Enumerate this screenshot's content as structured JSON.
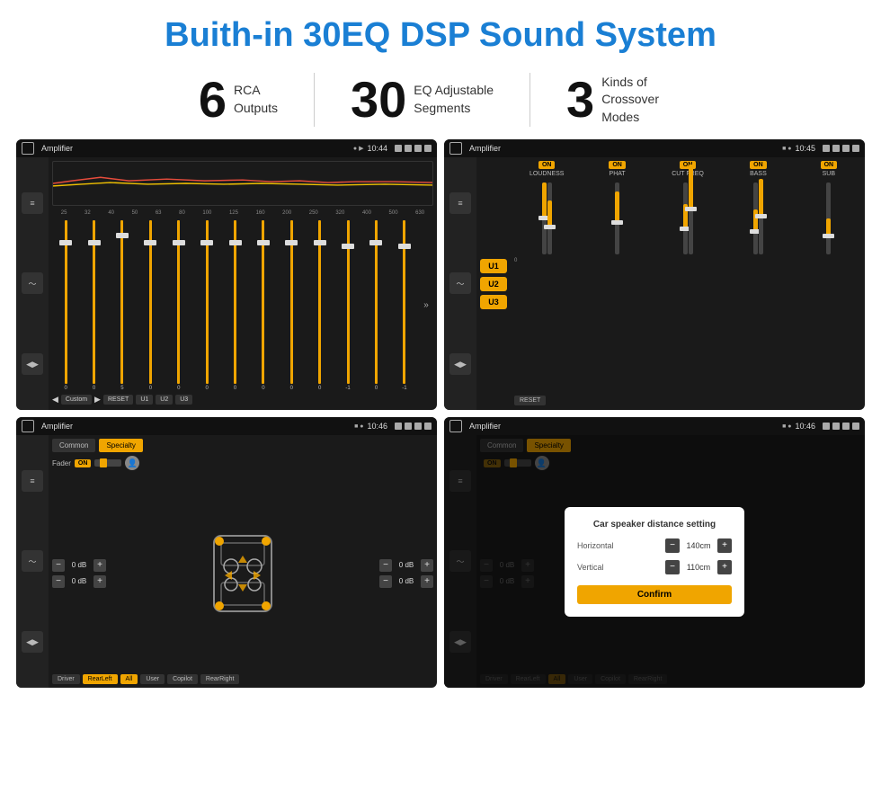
{
  "page": {
    "title": "Buith-in 30EQ DSP Sound System",
    "stats": [
      {
        "number": "6",
        "label": "RCA\nOutputs"
      },
      {
        "number": "30",
        "label": "EQ Adjustable\nSegments"
      },
      {
        "number": "3",
        "label": "Kinds of\nCrossover Modes"
      }
    ]
  },
  "screen1": {
    "app_title": "Amplifier",
    "time": "10:44",
    "eq_freqs": [
      "25",
      "32",
      "40",
      "50",
      "63",
      "80",
      "100",
      "125",
      "160",
      "200",
      "250",
      "320",
      "400",
      "500",
      "630"
    ],
    "eq_values": [
      "0",
      "0",
      "0",
      "5",
      "0",
      "0",
      "0",
      "0",
      "0",
      "0",
      "0",
      "0",
      "-1",
      "0",
      "-1"
    ],
    "preset_label": "Custom",
    "buttons": [
      "RESET",
      "U1",
      "U2",
      "U3"
    ]
  },
  "screen2": {
    "app_title": "Amplifier",
    "time": "10:45",
    "u_buttons": [
      "U1",
      "U2",
      "U3"
    ],
    "channels": [
      "LOUDNESS",
      "PHAT",
      "CUT FREQ",
      "BASS",
      "SUB"
    ],
    "on_labels": [
      "ON",
      "ON",
      "ON",
      "ON",
      "ON"
    ],
    "reset_label": "RESET"
  },
  "screen3": {
    "app_title": "Amplifier",
    "time": "10:46",
    "tabs": [
      "Common",
      "Specialty"
    ],
    "fader_label": "Fader",
    "on_label": "ON",
    "db_controls": [
      {
        "value": "0 dB"
      },
      {
        "value": "0 dB"
      },
      {
        "value": "0 dB"
      },
      {
        "value": "0 dB"
      }
    ],
    "bottom_buttons": [
      "Driver",
      "RearLeft",
      "All",
      "User",
      "Copilot",
      "RearRight"
    ]
  },
  "screen4": {
    "app_title": "Amplifier",
    "time": "10:46",
    "tabs": [
      "Common",
      "Specialty"
    ],
    "on_label": "ON",
    "dialog": {
      "title": "Car speaker distance setting",
      "horizontal_label": "Horizontal",
      "horizontal_value": "140cm",
      "vertical_label": "Vertical",
      "vertical_value": "110cm",
      "confirm_label": "Confirm"
    },
    "db_controls": [
      {
        "value": "0 dB"
      },
      {
        "value": "0 dB"
      }
    ],
    "bottom_buttons": [
      "Driver",
      "RearLeft",
      "All",
      "User",
      "Copilot",
      "RearRight"
    ]
  }
}
